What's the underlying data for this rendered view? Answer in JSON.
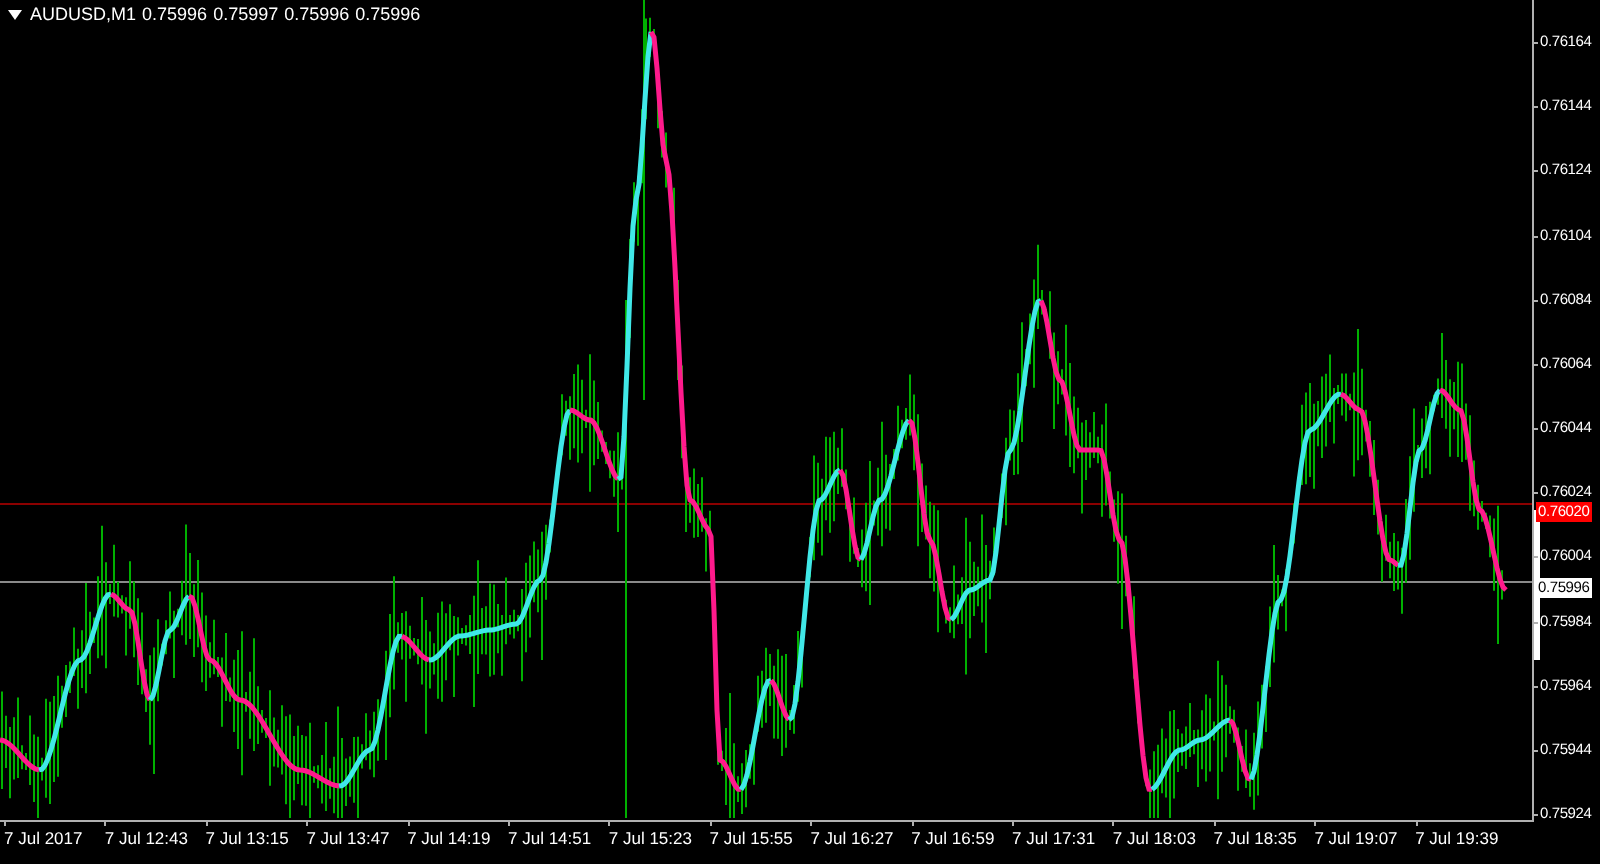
{
  "chart": {
    "symbol": "AUDUSD,M1",
    "quote": [
      "0.75996",
      "0.75997",
      "0.75996",
      "0.75996"
    ]
  },
  "price_axis": [
    "0.76164",
    "0.76144",
    "0.76124",
    "0.76104",
    "0.76084",
    "0.76064",
    "0.76044",
    "0.76024",
    "0.76004",
    "0.75984",
    "0.75964",
    "0.75944",
    "0.75924"
  ],
  "price_tags": [
    {
      "kind": "alert",
      "label": "0.76020"
    },
    {
      "kind": "bid",
      "label": "0.75996"
    }
  ],
  "time_axis": [
    "7 Jul 2017",
    "7 Jul 12:43",
    "7 Jul 13:15",
    "7 Jul 13:47",
    "7 Jul 14:19",
    "7 Jul 14:51",
    "7 Jul 15:23",
    "7 Jul 15:55",
    "7 Jul 16:27",
    "7 Jul 16:59",
    "7 Jul 17:31",
    "7 Jul 18:03",
    "7 Jul 18:35",
    "7 Jul 19:07",
    "7 Jul 19:39"
  ]
}
